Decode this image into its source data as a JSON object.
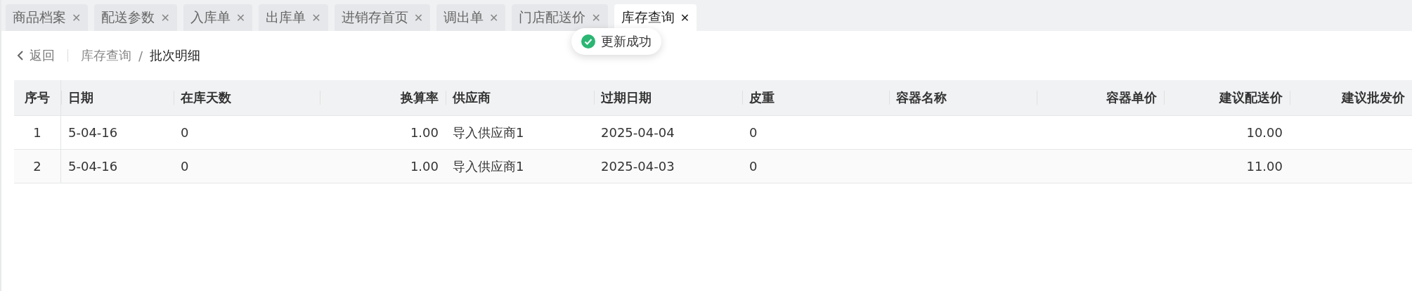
{
  "tabs": [
    {
      "label": "商品档案",
      "close": "✕",
      "selected": false
    },
    {
      "label": "配送参数",
      "close": "✕",
      "selected": false
    },
    {
      "label": "入库单",
      "close": "✕",
      "selected": false
    },
    {
      "label": "出库单",
      "close": "✕",
      "selected": false
    },
    {
      "label": "进销存首页",
      "close": "✕",
      "selected": false
    },
    {
      "label": "调出单",
      "close": "✕",
      "selected": false
    },
    {
      "label": "门店配送价",
      "close": "✕",
      "selected": false
    },
    {
      "label": "库存查询",
      "close": "✕",
      "selected": true
    }
  ],
  "toast": {
    "message": "更新成功"
  },
  "breadcrumb": {
    "back": "返回",
    "items": [
      "库存查询",
      "批次明细"
    ],
    "separator": "/"
  },
  "table": {
    "columns": [
      "序号",
      "日期",
      "在库天数",
      "换算率",
      "供应商",
      "过期日期",
      "皮重",
      "容器名称",
      "容器单价",
      "建议配送价",
      "建议批发价"
    ],
    "rows": [
      [
        "1",
        "5-04-16",
        "0",
        "1.00",
        "导入供应商1",
        "2025-04-04",
        "0",
        "",
        "",
        "10.00",
        ""
      ],
      [
        "2",
        "5-04-16",
        "0",
        "1.00",
        "导入供应商1",
        "2025-04-03",
        "0",
        "",
        "",
        "11.00",
        ""
      ]
    ]
  }
}
